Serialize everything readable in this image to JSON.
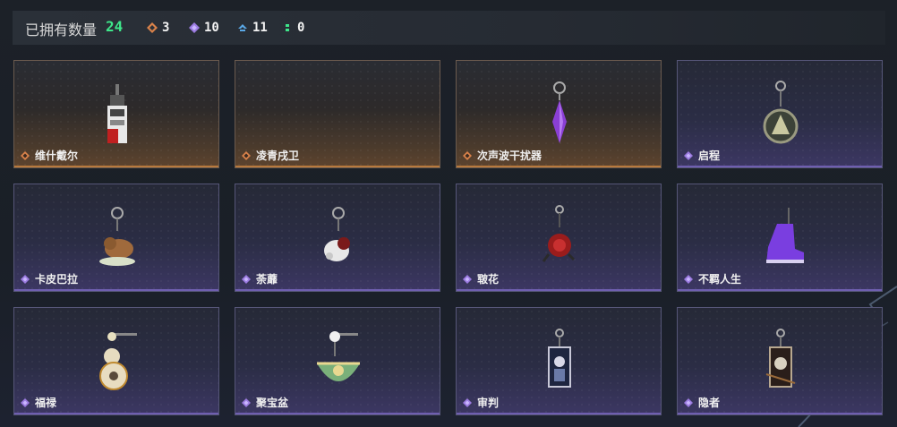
{
  "header": {
    "title": "已拥有数量",
    "total": "24",
    "stats": [
      {
        "icon": "orange-rarity-icon",
        "count": "3",
        "color": "#d9824a"
      },
      {
        "icon": "purple-rarity-icon",
        "count": "10",
        "color": "#9b7be0"
      },
      {
        "icon": "blue-rarity-icon",
        "count": "11",
        "color": "#5aa8e6"
      },
      {
        "icon": "green-rarity-icon",
        "count": "0",
        "color": "#3ee68a"
      }
    ]
  },
  "items": [
    {
      "name": "维什戴尔",
      "rarity": "orange",
      "icon": "tag-charm-icon"
    },
    {
      "name": "凌青戌卫",
      "rarity": "orange",
      "icon": "empty-slot"
    },
    {
      "name": "次声波干扰器",
      "rarity": "orange",
      "icon": "crystal-charm-icon"
    },
    {
      "name": "启程",
      "rarity": "purple",
      "icon": "round-emblem-charm-icon"
    },
    {
      "name": "卡皮巴拉",
      "rarity": "purple",
      "icon": "capybara-charm-icon"
    },
    {
      "name": "荼蘼",
      "rarity": "purple",
      "icon": "flower-figure-charm-icon"
    },
    {
      "name": "皲花",
      "rarity": "purple",
      "icon": "red-rose-charm-icon"
    },
    {
      "name": "不羁人生",
      "rarity": "purple",
      "icon": "sneaker-charm-icon"
    },
    {
      "name": "福禄",
      "rarity": "purple",
      "icon": "gourd-charm-icon"
    },
    {
      "name": "聚宝盆",
      "rarity": "purple",
      "icon": "treasure-bowl-charm-icon"
    },
    {
      "name": "审判",
      "rarity": "purple",
      "icon": "judgement-card-charm-icon"
    },
    {
      "name": "隐者",
      "rarity": "purple",
      "icon": "hermit-card-charm-icon"
    }
  ]
}
